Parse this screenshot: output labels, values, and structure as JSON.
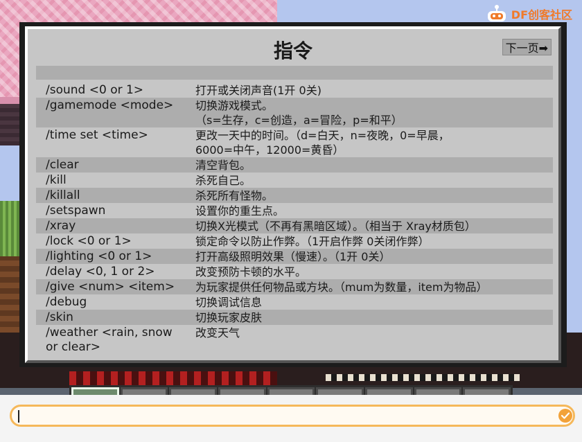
{
  "logo": {
    "text": "DF创客社区",
    "icon": "robot-icon"
  },
  "panel": {
    "title": "指令",
    "next_page_label": "下一页➡"
  },
  "commands": [
    {
      "cmd": "/sound <0 or 1>",
      "desc": "打开或关闭声音(1开   0关)"
    },
    {
      "cmd": "/gamemode <mode>",
      "desc": "切换游戏模式。\n（s=生存，c=创造，a=冒险，p=和平）"
    },
    {
      "cmd": "/time set <time>",
      "desc": "更改一天中的时间。（d=白天，n=夜晚，0=早晨，\n6000=中午，12000=黄昏）"
    },
    {
      "cmd": "/clear",
      "desc": "清空背包。"
    },
    {
      "cmd": "/kill",
      "desc": "杀死自己。"
    },
    {
      "cmd": "/killall",
      "desc": "杀死所有怪物。"
    },
    {
      "cmd": "/setspawn",
      "desc": "设置你的重生点。"
    },
    {
      "cmd": "/xray",
      "desc": "切换X光模式（不再有黑暗区域）。（相当于 Xray材质包）"
    },
    {
      "cmd": "/lock <0 or 1>",
      "desc": "锁定命令以防止作弊。（1开启作弊       0关闭作弊）"
    },
    {
      "cmd": "/lighting <0 or 1>",
      "desc": "打开高级照明效果（慢速）。（1开     0关）"
    },
    {
      "cmd": "/delay <0, 1 or 2>",
      "desc": "改变预防卡顿的水平。"
    },
    {
      "cmd": "/give <num> <item>",
      "desc": "为玩家提供任何物品或方块。（mum为数量，item为物品）"
    },
    {
      "cmd": "/debug",
      "desc": "切换调试信息"
    },
    {
      "cmd": "/skin",
      "desc": "切换玩家皮肤"
    },
    {
      "cmd": "/weather <rain, snow or clear>",
      "desc": "改变天气"
    }
  ],
  "chat": {
    "value": "",
    "placeholder": "",
    "submit_icon": "check-circle-icon"
  },
  "colors": {
    "accent": "#f2a23a",
    "panel": "#c6c6c6",
    "row_shade": "#adadad"
  }
}
